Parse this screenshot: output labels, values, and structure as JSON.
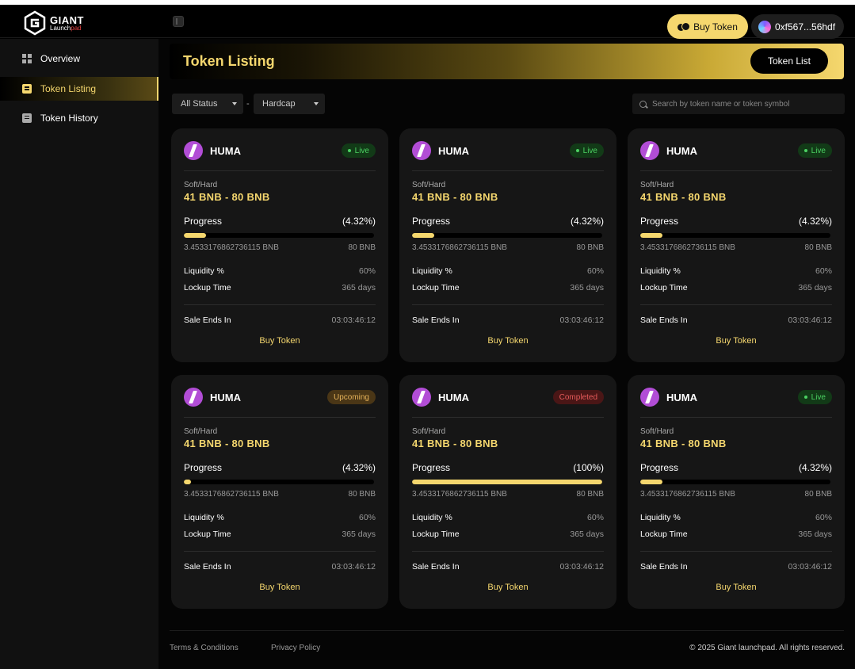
{
  "brand": {
    "name": "GIANT",
    "sub_a": "Launch",
    "sub_b": "pad"
  },
  "header": {
    "buy_label": "Buy Token",
    "wallet_label": "0xf567...56hdf"
  },
  "sidebar": {
    "items": [
      {
        "label": "Overview",
        "icon": "grid-icon",
        "active": false
      },
      {
        "label": "Token Listing",
        "icon": "listing-icon",
        "active": true
      },
      {
        "label": "Token History",
        "icon": "clipboard-icon",
        "active": false
      }
    ]
  },
  "page": {
    "title": "Token Listing",
    "token_list_label": "Token List"
  },
  "filters": {
    "status": "All Status",
    "separator": "-",
    "cap": "Hardcap",
    "search_placeholder": "Search by token name or token symbol"
  },
  "card_labels": {
    "soft_hard": "Soft/Hard",
    "progress": "Progress",
    "liquidity": "Liquidity %",
    "lockup": "Lockup Time",
    "sale_ends": "Sale Ends In",
    "buy": "Buy Token"
  },
  "cards": [
    {
      "name": "HUMA",
      "status": "Live",
      "status_kind": "live",
      "range": "41 BNB - 80 BNB",
      "progress_text": "(4.32%)",
      "progress": 0.1165,
      "raised": "3.4533176862736115 BNB",
      "hardcap": "80 BNB",
      "liquidity": "60%",
      "lockup": "365 days",
      "ends_in": "03:03:46:12"
    },
    {
      "name": "HUMA",
      "status": "Live",
      "status_kind": "live",
      "range": "41 BNB - 80 BNB",
      "progress_text": "(4.32%)",
      "progress": 0.1165,
      "raised": "3.4533176862736115 BNB",
      "hardcap": "80 BNB",
      "liquidity": "60%",
      "lockup": "365 days",
      "ends_in": "03:03:46:12"
    },
    {
      "name": "HUMA",
      "status": "Live",
      "status_kind": "live",
      "range": "41 BNB - 80 BNB",
      "progress_text": "(4.32%)",
      "progress": 0.1165,
      "raised": "3.4533176862736115 BNB",
      "hardcap": "80 BNB",
      "liquidity": "60%",
      "lockup": "365 days",
      "ends_in": "03:03:46:12"
    },
    {
      "name": "HUMA",
      "status": "Upcoming",
      "status_kind": "upcoming",
      "range": "41 BNB - 80 BNB",
      "progress_text": "(4.32%)",
      "progress": 0.0375,
      "raised": "3.4533176862736115 BNB",
      "hardcap": "80 BNB",
      "liquidity": "60%",
      "lockup": "365 days",
      "ends_in": "03:03:46:12"
    },
    {
      "name": "HUMA",
      "status": "Completed",
      "status_kind": "completed",
      "range": "41 BNB - 80 BNB",
      "progress_text": "(100%)",
      "progress": 1.0,
      "raised": "3.4533176862736115 BNB",
      "hardcap": "80 BNB",
      "liquidity": "60%",
      "lockup": "365 days",
      "ends_in": "03:03:46:12"
    },
    {
      "name": "HUMA",
      "status": "Live",
      "status_kind": "live",
      "range": "41 BNB - 80 BNB",
      "progress_text": "(4.32%)",
      "progress": 0.1165,
      "raised": "3.4533176862736115 BNB",
      "hardcap": "80 BNB",
      "liquidity": "60%",
      "lockup": "365 days",
      "ends_in": "03:03:46:12"
    }
  ],
  "footer": {
    "terms": "Terms & Conditions",
    "privacy": "Privacy Policy",
    "copyright": "© 2025 Giant launchpad. All rights reserved."
  },
  "colors": {
    "accent": "#f5d76e",
    "background": "#000000",
    "card": "#161616",
    "live": "#4bd162",
    "upcoming": "#e5b25a",
    "completed": "#e55a5a"
  }
}
